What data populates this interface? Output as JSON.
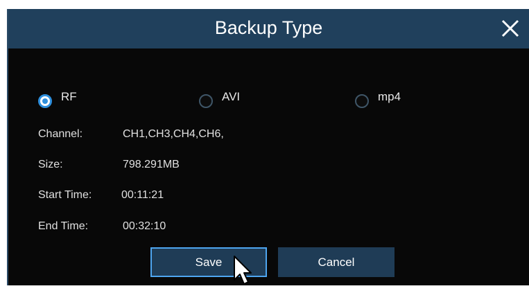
{
  "dialog": {
    "title": "Backup Type",
    "close_icon": "close-icon"
  },
  "backup_type": {
    "selected": "RF",
    "options": [
      {
        "label": "RF",
        "checked": true
      },
      {
        "label": "AVI",
        "checked": false
      },
      {
        "label": "mp4",
        "checked": false
      }
    ]
  },
  "info": {
    "channel_label": "Channel:",
    "channel_value": "CH1,CH3,CH4,CH6,",
    "size_label": "Size:",
    "size_value": "798.291MB",
    "start_label": "Start Time:",
    "start_value": "00:11:21",
    "end_label": "End Time:",
    "end_value": "00:32:10"
  },
  "buttons": {
    "save": "Save",
    "cancel": "Cancel"
  },
  "colors": {
    "titlebar": "#20405c",
    "background": "#080808",
    "accent": "#2e8fdd",
    "button": "#1f3c56"
  }
}
